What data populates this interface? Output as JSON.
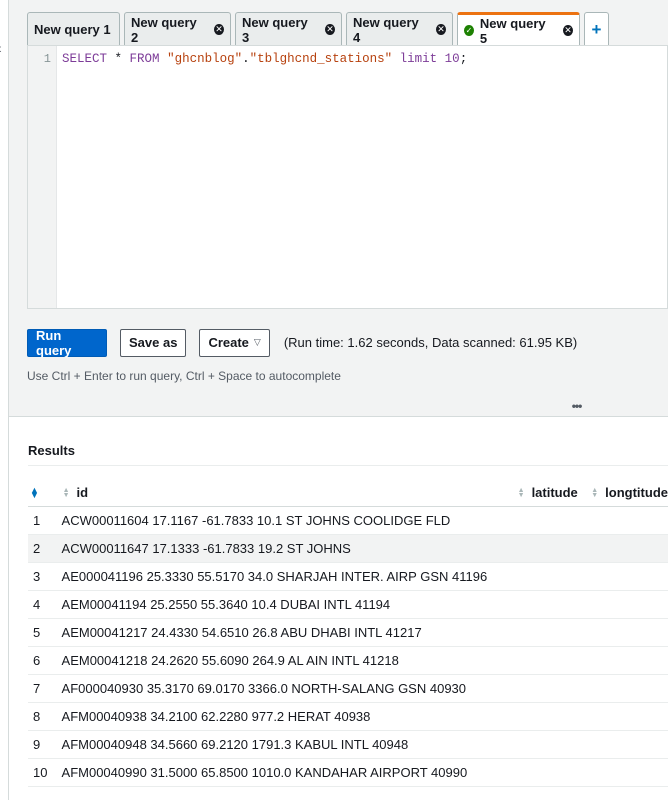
{
  "tabs": [
    {
      "label": "New query 1",
      "closable": false,
      "active": false
    },
    {
      "label": "New query 2",
      "closable": true,
      "active": false
    },
    {
      "label": "New query 3",
      "closable": true,
      "active": false
    },
    {
      "label": "New query 4",
      "closable": true,
      "active": false
    },
    {
      "label": "New query 5",
      "closable": true,
      "active": true,
      "status": "success"
    }
  ],
  "add_tab_label": "+",
  "editor": {
    "line_number": "1",
    "query_parts": {
      "select": "SELECT",
      "star": " * ",
      "from": "FROM",
      "db": "\"ghcnblog\"",
      "dot": ".",
      "table": "\"tblghcnd_stations\"",
      "limit": "limit",
      "limit_value": "10",
      "semicolon": ";"
    }
  },
  "actions": {
    "run_label": "Run query",
    "save_label": "Save as",
    "create_label": "Create",
    "run_info": "(Run time: 1.62 seconds, Data scanned: 61.95 KB)"
  },
  "hint": "Use Ctrl + Enter to run query, Ctrl + Space to autocomplete",
  "results": {
    "title": "Results",
    "columns": [
      "id",
      "latitude",
      "longtitude"
    ],
    "rows": [
      {
        "n": "1",
        "id": "ACW00011604 17.1167 -61.7833 10.1 ST JOHNS COOLIDGE FLD"
      },
      {
        "n": "2",
        "id": "ACW00011647 17.1333 -61.7833 19.2 ST JOHNS"
      },
      {
        "n": "3",
        "id": "AE000041196 25.3330 55.5170 34.0 SHARJAH INTER. AIRP GSN 41196"
      },
      {
        "n": "4",
        "id": "AEM00041194 25.2550 55.3640 10.4 DUBAI INTL 41194"
      },
      {
        "n": "5",
        "id": "AEM00041217 24.4330 54.6510 26.8 ABU DHABI INTL 41217"
      },
      {
        "n": "6",
        "id": "AEM00041218 24.2620 55.6090 264.9 AL AIN INTL 41218"
      },
      {
        "n": "7",
        "id": "AF000040930 35.3170 69.0170 3366.0 NORTH-SALANG GSN 40930"
      },
      {
        "n": "8",
        "id": "AFM00040938 34.2100 62.2280 977.2 HERAT 40938"
      },
      {
        "n": "9",
        "id": "AFM00040948 34.5660 69.2120 1791.3 KABUL INTL 40948"
      },
      {
        "n": "10",
        "id": "AFM00040990 31.5000 65.8500 1010.0 KANDAHAR AIRPORT 40990"
      }
    ]
  },
  "colors": {
    "primary": "#0066cc",
    "active_tab_accent": "#ec7211",
    "success": "#1d8102"
  }
}
